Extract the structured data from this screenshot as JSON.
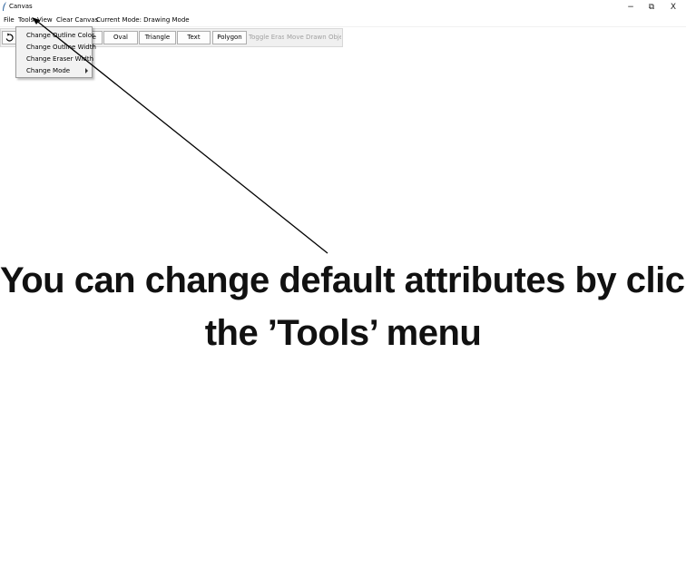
{
  "window": {
    "title": "Canvas",
    "minimize_glyph": "−",
    "maximize_glyph": "⧉",
    "close_glyph": "X"
  },
  "menubar": {
    "file": "File",
    "tools": "Tools",
    "view": "View",
    "clear_canvas": "Clear Canvas",
    "current_mode": "Current Mode: Drawing Mode"
  },
  "toolbar": {
    "undo_icon": "undo-icon",
    "rectangle_partial": "le",
    "oval": "Oval",
    "triangle": "Triangle",
    "text": "Text",
    "polygon": "Polygon",
    "toggle_eraser": "Toggle Eraser",
    "move_drawn_objects": "Move Drawn Objects"
  },
  "tools_menu": {
    "items": [
      {
        "label": "Change Outline Color"
      },
      {
        "label": "Change Outline Width"
      },
      {
        "label": "Change Eraser Width"
      },
      {
        "label": "Change Mode",
        "has_submenu": true
      }
    ]
  },
  "annotation": {
    "line1": "You can change default attributes by clicking on",
    "line2": "the ’Tools’ menu"
  },
  "colors": {
    "background": "#ffffff",
    "menu_background": "#f2f2f2",
    "toolbar_background": "#f0f0f0",
    "disabled_text": "#a0a0a0",
    "annotation_text": "#111111"
  }
}
